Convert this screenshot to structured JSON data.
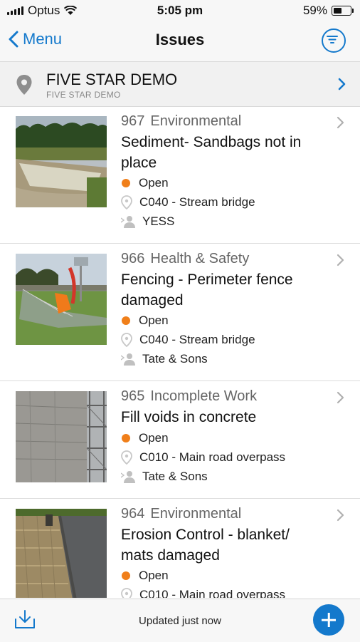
{
  "status": {
    "carrier": "Optus",
    "time": "5:05 pm",
    "battery": "59%",
    "battery_level": 0.59
  },
  "nav": {
    "back_label": "Menu",
    "title": "Issues",
    "filter_icon": "filter-icon"
  },
  "project": {
    "name": "FIVE STAR DEMO",
    "subtitle": "FIVE STAR DEMO"
  },
  "issues": [
    {
      "number": "967",
      "category": "Environmental",
      "title": "Sediment- Sandbags not in place",
      "status": "Open",
      "location": "C040 - Stream bridge",
      "assignee": "YESS"
    },
    {
      "number": "966",
      "category": "Health & Safety",
      "title": "Fencing - Perimeter fence damaged",
      "status": "Open",
      "location": "C040 - Stream bridge",
      "assignee": "Tate & Sons"
    },
    {
      "number": "965",
      "category": "Incomplete Work",
      "title": "Fill voids in concrete",
      "status": "Open",
      "location": "C010 - Main road overpass",
      "assignee": "Tate & Sons"
    },
    {
      "number": "964",
      "category": "Environmental",
      "title": "Erosion Control - blanket/ mats damaged",
      "status": "Open",
      "location": "C010 - Main road overpass",
      "assignee": ""
    }
  ],
  "footer": {
    "updated_text": "Updated just now"
  },
  "colors": {
    "accent": "#1479cc",
    "status_open": "#f07f1a"
  }
}
